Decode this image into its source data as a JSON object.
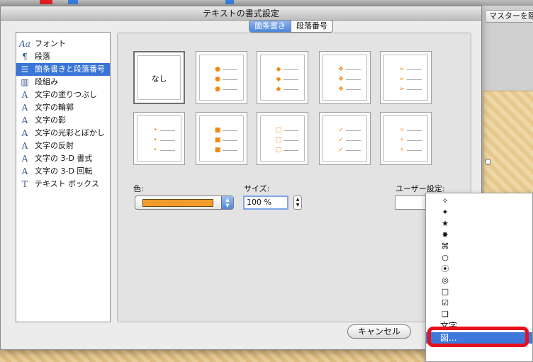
{
  "background": {
    "master_button_label": "マスターを隠",
    "toolbar_colors": [
      "#e02020",
      "#3a7de0",
      "#e0a020"
    ]
  },
  "dialog": {
    "title": "テキストの書式設定"
  },
  "sidebar": {
    "items": [
      {
        "label": "フォント",
        "icon": "font-icon"
      },
      {
        "label": "段落",
        "icon": "paragraph-icon"
      },
      {
        "label": "箇条書きと段落番号",
        "icon": "bullets-icon",
        "selected": true
      },
      {
        "label": "段組み",
        "icon": "columns-icon"
      },
      {
        "label": "文字の塗りつぶし",
        "icon": "text-fill-icon"
      },
      {
        "label": "文字の輪郭",
        "icon": "text-outline-icon"
      },
      {
        "label": "文字の影",
        "icon": "text-shadow-icon"
      },
      {
        "label": "文字の光彩とぼかし",
        "icon": "text-glow-icon"
      },
      {
        "label": "文字の反射",
        "icon": "text-reflection-icon"
      },
      {
        "label": "文字の 3-D 書式",
        "icon": "text-3d-format-icon"
      },
      {
        "label": "文字の 3-D 回転",
        "icon": "text-3d-rotation-icon"
      },
      {
        "label": "テキスト ボックス",
        "icon": "text-box-icon"
      }
    ]
  },
  "tabs": [
    {
      "label": "箇条書き",
      "active": true
    },
    {
      "label": "段落番号",
      "active": false
    }
  ],
  "bullet_styles": {
    "none_label": "なし",
    "accent": "#f08a12",
    "options": [
      {
        "symbol": "none",
        "glyph": ""
      },
      {
        "symbol": "dot",
        "glyph": "●"
      },
      {
        "symbol": "diamond",
        "glyph": "◆"
      },
      {
        "symbol": "four-diamond",
        "glyph": "❖"
      },
      {
        "symbol": "arrowhead",
        "glyph": "➢"
      },
      {
        "symbol": "small-dot",
        "glyph": "•"
      },
      {
        "symbol": "square",
        "glyph": "■"
      },
      {
        "symbol": "hollow-square",
        "glyph": "□"
      },
      {
        "symbol": "check",
        "glyph": "✓"
      },
      {
        "symbol": "four-star",
        "glyph": "✧"
      }
    ]
  },
  "controls": {
    "color_label": "色:",
    "color_value": "#f29b2a",
    "size_label": "サイズ:",
    "size_value": "100 %",
    "custom_label": "ユーザー設定:",
    "cancel_label": "キャンセル"
  },
  "custom_menu": {
    "items": [
      {
        "glyph": "✧"
      },
      {
        "glyph": "✦"
      },
      {
        "glyph": "★"
      },
      {
        "glyph": "✸"
      },
      {
        "glyph": "⌘"
      },
      {
        "glyph": "○"
      },
      {
        "glyph": "⦿"
      },
      {
        "glyph": "◎"
      },
      {
        "glyph": "□"
      },
      {
        "glyph": "☑"
      },
      {
        "glyph": "❏"
      },
      {
        "label": "文字"
      },
      {
        "label": "図...",
        "selected": true
      }
    ]
  }
}
